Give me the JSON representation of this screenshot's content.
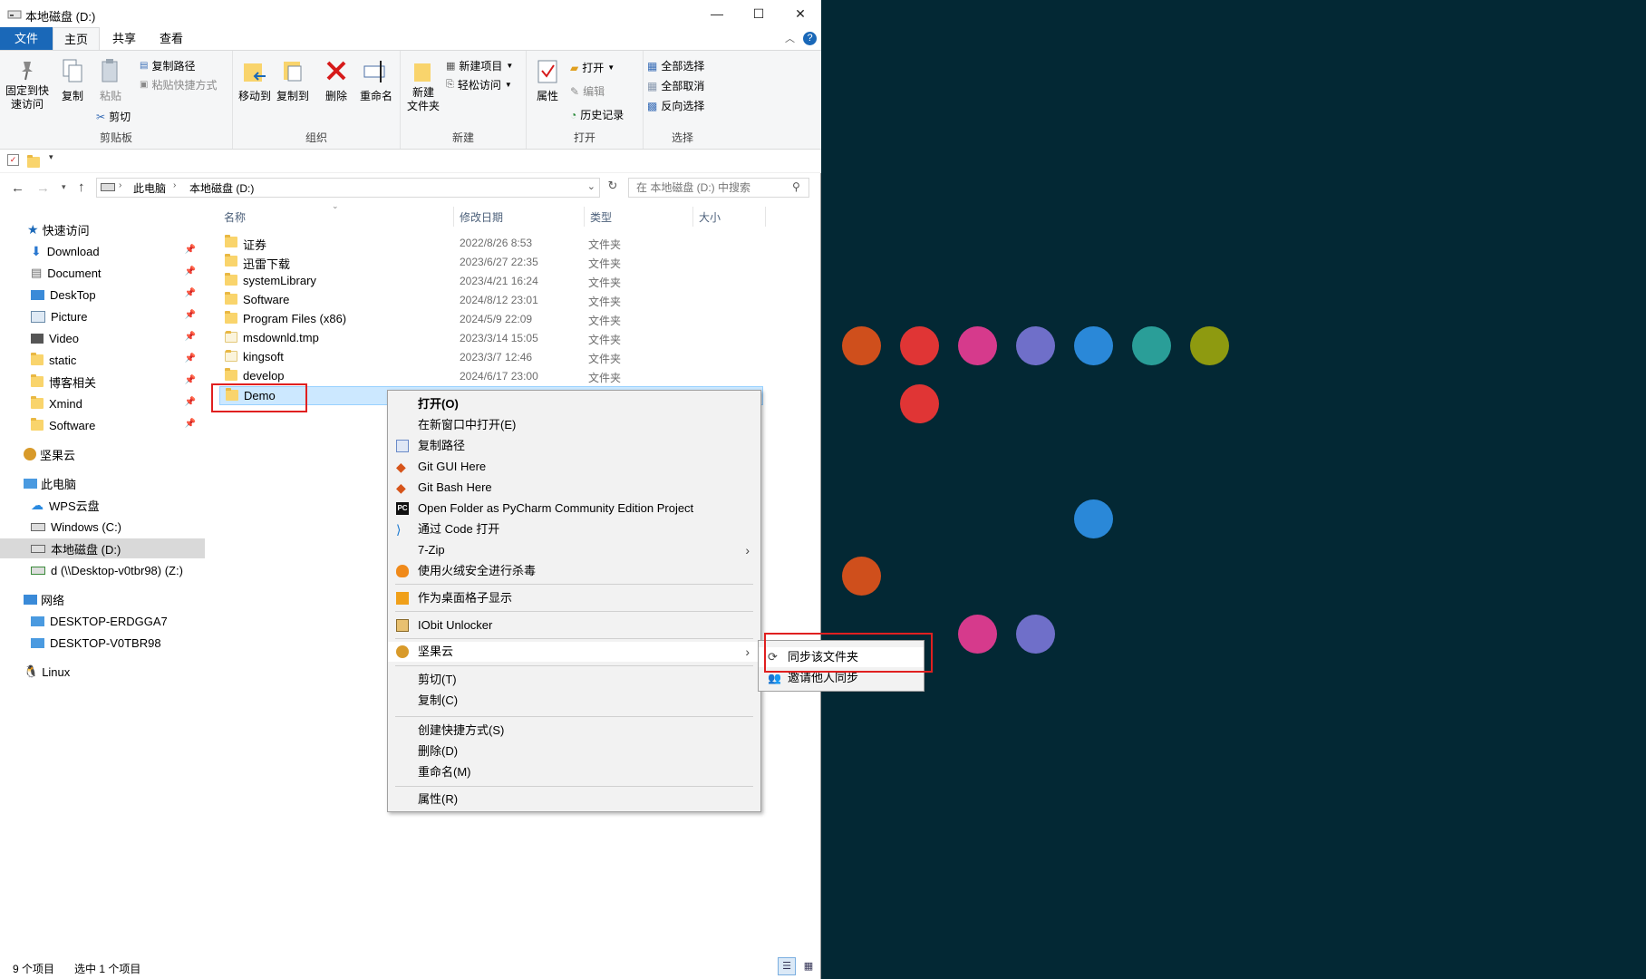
{
  "window": {
    "title": "本地磁盘 (D:)",
    "controls": {
      "minimize": "—",
      "maximize": "☐",
      "close": "✕"
    }
  },
  "ribbon_tabs": [
    "文件",
    "主页",
    "共享",
    "查看"
  ],
  "ribbon": {
    "clipboard": {
      "pin": "固定到快\n速访问",
      "copy": "复制",
      "paste": "粘贴",
      "copy_path": "复制路径",
      "paste_shortcut": "粘贴快捷方式",
      "cut": "剪切",
      "label": "剪贴板"
    },
    "organize": {
      "move_to": "移动到",
      "copy_to": "复制到",
      "delete": "删除",
      "rename": "重命名",
      "label": "组织"
    },
    "new": {
      "new_folder": "新建\n文件夹",
      "new_item": "新建项目",
      "easy_access": "轻松访问",
      "label": "新建"
    },
    "open": {
      "properties": "属性",
      "open": "打开",
      "edit": "编辑",
      "history": "历史记录",
      "label": "打开"
    },
    "select": {
      "select_all": "全部选择",
      "select_none": "全部取消",
      "invert": "反向选择",
      "label": "选择"
    }
  },
  "address": {
    "crumbs": [
      "此电脑",
      "本地磁盘 (D:)"
    ],
    "search_placeholder": "在 本地磁盘 (D:) 中搜索"
  },
  "nav": {
    "quick_access": "快速访问",
    "quick_items": [
      "Download",
      "Document",
      "DeskTop",
      "Picture",
      "Video",
      "static",
      "博客相关",
      "Xmind",
      "Software"
    ],
    "jianguoyun": "坚果云",
    "this_pc": "此电脑",
    "pc_items": [
      "WPS云盘",
      "Windows (C:)",
      "本地磁盘 (D:)",
      "d (\\\\Desktop-v0tbr98) (Z:)"
    ],
    "network": "网络",
    "network_items": [
      "DESKTOP-ERDGGA7",
      "DESKTOP-V0TBR98"
    ],
    "linux": "Linux"
  },
  "columns": {
    "name": "名称",
    "date": "修改日期",
    "type": "类型",
    "size": "大小"
  },
  "files": [
    {
      "name": "证券",
      "date": "2022/8/26 8:53",
      "type": "文件夹"
    },
    {
      "name": "迅雷下载",
      "date": "2023/6/27 22:35",
      "type": "文件夹"
    },
    {
      "name": "systemLibrary",
      "date": "2023/4/21 16:24",
      "type": "文件夹"
    },
    {
      "name": "Software",
      "date": "2024/8/12 23:01",
      "type": "文件夹"
    },
    {
      "name": "Program Files (x86)",
      "date": "2024/5/9 22:09",
      "type": "文件夹"
    },
    {
      "name": "msdownld.tmp",
      "date": "2023/3/14 15:05",
      "type": "文件夹"
    },
    {
      "name": "kingsoft",
      "date": "2023/3/7 12:46",
      "type": "文件夹"
    },
    {
      "name": "develop",
      "date": "2024/6/17 23:00",
      "type": "文件夹"
    },
    {
      "name": "Demo",
      "date": "",
      "type": ""
    }
  ],
  "context_menu": {
    "open": "打开(O)",
    "open_new_window": "在新窗口中打开(E)",
    "copy_path": "复制路径",
    "git_gui": "Git GUI Here",
    "git_bash": "Git Bash Here",
    "pycharm": "Open Folder as PyCharm Community Edition Project",
    "vscode": "通过 Code 打开",
    "sevenzip": "7-Zip",
    "huorong": "使用火绒安全进行杀毒",
    "desktop_grid": "作为桌面格子显示",
    "iobit": "IObit Unlocker",
    "jianguoyun": "坚果云",
    "cut": "剪切(T)",
    "copy": "复制(C)",
    "create_shortcut": "创建快捷方式(S)",
    "delete": "删除(D)",
    "rename": "重命名(M)",
    "properties": "属性(R)"
  },
  "submenu": {
    "sync": "同步该文件夹",
    "invite": "邀请他人同步"
  },
  "status": {
    "count": "9 个项目",
    "selected": "选中 1 个项目"
  },
  "colors": {
    "orange": "#cf4f1c",
    "red": "#e03535",
    "pink": "#d63a8c",
    "purple": "#6f6fc9",
    "blue": "#2a88d8",
    "teal": "#2a9e98",
    "olive": "#8e9a10"
  }
}
